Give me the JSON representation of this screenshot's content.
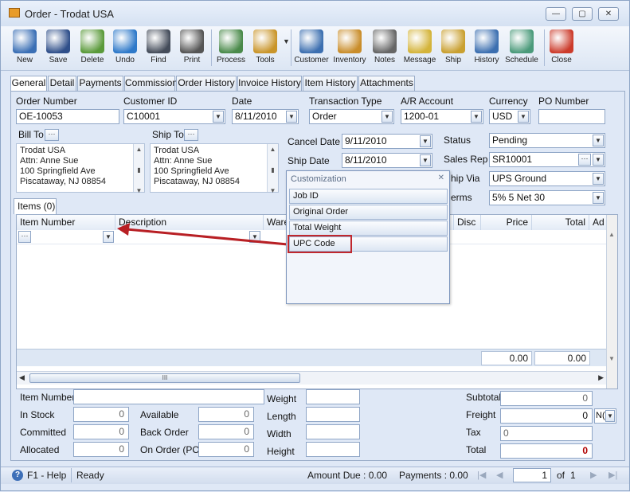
{
  "window": {
    "title": "Order - Trodat USA"
  },
  "window_buttons": [
    "—",
    "▢",
    "✕"
  ],
  "toolbar": [
    {
      "label": "New",
      "icon": "new-icon",
      "color": "#3a6fb5"
    },
    {
      "label": "Save",
      "icon": "save-icon",
      "color": "#2f4f8a"
    },
    {
      "label": "Delete",
      "icon": "delete-icon",
      "color": "#5a9a3a"
    },
    {
      "label": "Undo",
      "icon": "undo-icon",
      "color": "#2e79c9"
    },
    {
      "label": "Find",
      "icon": "find-icon",
      "color": "#444c5a"
    },
    {
      "label": "Print",
      "icon": "print-icon",
      "color": "#555555"
    },
    {
      "label": "Process",
      "icon": "process-icon",
      "color": "#4a8a4a"
    },
    {
      "label": "Tools",
      "icon": "tools-icon",
      "color": "#c9952a"
    },
    {
      "label": "Customer",
      "icon": "customer-icon",
      "color": "#3c6fb0"
    },
    {
      "label": "Inventory",
      "icon": "inventory-icon",
      "color": "#c98d2a"
    },
    {
      "label": "Notes",
      "icon": "notes-icon",
      "color": "#666666"
    },
    {
      "label": "Message",
      "icon": "message-icon",
      "color": "#d4b43a"
    },
    {
      "label": "Ship",
      "icon": "ship-icon",
      "color": "#c9a030"
    },
    {
      "label": "History",
      "icon": "history-icon",
      "color": "#3c6fb0"
    },
    {
      "label": "Schedule",
      "icon": "schedule-icon",
      "color": "#4a9a7a"
    },
    {
      "label": "Close",
      "icon": "close-icon",
      "color": "#cc3b2b"
    }
  ],
  "tabs": [
    "General",
    "Detail",
    "Payments",
    "Commission",
    "Order History",
    "Invoice History",
    "Item History",
    "Attachments"
  ],
  "header_fields": {
    "order_number": {
      "label": "Order Number",
      "value": "OE-10053"
    },
    "customer_id": {
      "label": "Customer ID",
      "value": "C10001"
    },
    "date": {
      "label": "Date",
      "value": "8/11/2010"
    },
    "transaction_type": {
      "label": "Transaction Type",
      "value": "Order"
    },
    "ar_account": {
      "label": "A/R Account",
      "value": "1200-01"
    },
    "currency": {
      "label": "Currency",
      "value": "USD"
    },
    "po_number": {
      "label": "PO Number",
      "value": ""
    }
  },
  "bill_to": {
    "label": "Bill To",
    "lines": [
      "Trodat USA",
      "Attn: Anne Sue",
      "100 Springfield Ave",
      "Piscataway, NJ 08854"
    ]
  },
  "ship_to": {
    "label": "Ship To",
    "lines": [
      "Trodat USA",
      "Attn: Anne Sue",
      "100 Springfield Ave",
      "Piscataway, NJ 08854"
    ]
  },
  "cancel_date": {
    "label": "Cancel  Date",
    "value": "9/11/2010"
  },
  "ship_date": {
    "label": "Ship Date",
    "value": "8/11/2010"
  },
  "status": {
    "label": "Status",
    "value": "Pending"
  },
  "sales_rep": {
    "label": "Sales Rep",
    "value": "SR10001"
  },
  "ship_via": {
    "label": "hip Via",
    "value": "UPS Ground"
  },
  "terms": {
    "label": "erms",
    "value": "5% 5 Net 30"
  },
  "items_tab": "Items (0)",
  "grid": {
    "columns": [
      "Item Number",
      "Description",
      "Wareh",
      "Disc",
      "Price",
      "Total",
      "Ad"
    ],
    "footer_price": "0.00",
    "footer_total": "0.00",
    "scroll_grip": "III"
  },
  "customization_menu": {
    "title": "Customization",
    "close": "✕",
    "items": [
      "Job ID",
      "Original Order",
      "Total Weight",
      "UPC Code"
    ],
    "highlight_color": "#c0272d",
    "arrow_color": "#b81f24"
  },
  "bottom": {
    "item_number": {
      "label": "Item Number",
      "value": ""
    },
    "in_stock": {
      "label": "In Stock",
      "value": "0"
    },
    "committed": {
      "label": "Committed",
      "value": "0"
    },
    "allocated": {
      "label": "Allocated",
      "value": "0"
    },
    "available": {
      "label": "Available",
      "value": "0"
    },
    "back_order": {
      "label": "Back Order",
      "value": "0"
    },
    "on_order": {
      "label": "On Order (PO)",
      "value": "0"
    },
    "weight": {
      "label": "Weight",
      "value": ""
    },
    "length": {
      "label": "Length",
      "value": ""
    },
    "width": {
      "label": "Width",
      "value": ""
    },
    "height": {
      "label": "Height",
      "value": ""
    },
    "subtotal": {
      "label": "Subtotal",
      "value": "0"
    },
    "freight": {
      "label": "Freight",
      "value": "0",
      "unit": "N("
    },
    "tax": {
      "label": "Tax",
      "value": "0"
    },
    "total": {
      "label": "Total",
      "value": "0"
    }
  },
  "status_bar": {
    "help": "F1 - Help",
    "state": "Ready",
    "amount_due": "Amount Due : 0.00",
    "payments": "Payments : 0.00",
    "page": "1",
    "of": "of",
    "pages": "1"
  }
}
